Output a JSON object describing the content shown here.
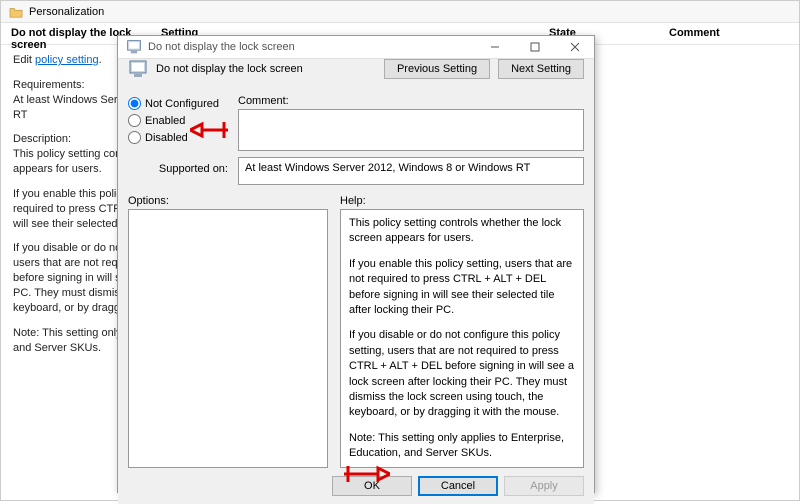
{
  "bg": {
    "title": "Personalization",
    "setting_title": "Do not display the lock screen",
    "columns": {
      "setting": "Setting",
      "state": "State",
      "comment": "Comment"
    },
    "edit_prefix": "Edit ",
    "edit_link": "policy setting",
    "requirements_label": "Requirements:",
    "requirements_text": "At least Windows Server 2012, Windows 8 or Windows RT",
    "description_label": "Description:",
    "description_text": "This policy setting controls whether the lock screen appears for users.",
    "p1": "If you enable this policy setting, users that are not required to press CTRL + ALT + DEL before signing in will see their selected tile after locking their PC.",
    "p2": "If you disable or do not configure this policy setting, users that are not required to press CTRL + ALT + DEL before signing in will see a lock screen after locking their PC. They must dismiss the lock screen using touch, the keyboard, or by dragging it with the mouse.",
    "p3": "Note: This setting only applies to Enterprise, Education, and Server SKUs."
  },
  "dialog": {
    "title": "Do not display the lock screen",
    "subtitle": "Do not display the lock screen",
    "prev_btn": "Previous Setting",
    "next_btn": "Next Setting",
    "radio": {
      "not_configured": "Not Configured",
      "enabled": "Enabled",
      "disabled": "Disabled"
    },
    "comment_label": "Comment:",
    "supported_label": "Supported on:",
    "supported_text": "At least Windows Server 2012, Windows 8 or Windows RT",
    "options_label": "Options:",
    "help_label": "Help:",
    "help_p1": "This policy setting controls whether the lock screen appears for users.",
    "help_p2": "If you enable this policy setting, users that are not required to press CTRL + ALT + DEL before signing in will see their selected tile after locking their PC.",
    "help_p3": "If you disable or do not configure this policy setting, users that are not required to press CTRL + ALT + DEL before signing in will see a lock screen after locking their PC. They must dismiss the lock screen using touch, the keyboard, or by dragging it with the mouse.",
    "help_p4": "Note: This setting only applies to Enterprise, Education, and Server SKUs.",
    "ok": "OK",
    "cancel": "Cancel",
    "apply": "Apply"
  }
}
